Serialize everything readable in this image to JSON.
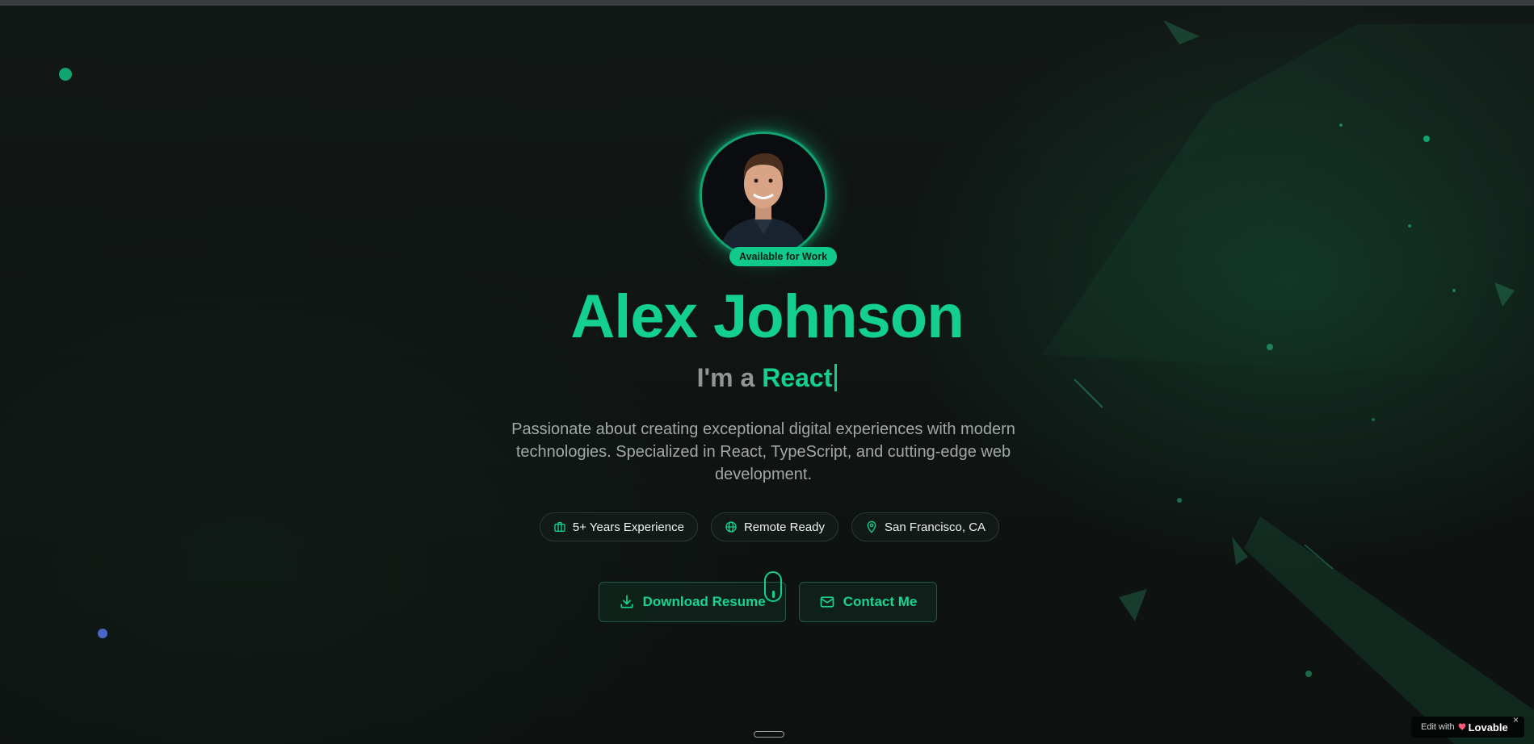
{
  "profile": {
    "name": "Alex Johnson",
    "badge": "Available for Work",
    "role_prefix": "I'm a",
    "role_word": "React",
    "description": "Passionate about creating exceptional digital experiences with modern technologies. Specialized in React, TypeScript, and cutting-edge web development."
  },
  "highlights": [
    {
      "icon": "briefcase-icon",
      "label": "5+ Years Experience"
    },
    {
      "icon": "globe-icon",
      "label": "Remote Ready"
    },
    {
      "icon": "map-pin-icon",
      "label": "San Francisco, CA"
    }
  ],
  "actions": {
    "download_label": "Download Resume",
    "contact_label": "Contact Me"
  },
  "lovable_badge": {
    "prefix": "Edit with",
    "brand": "Lovable",
    "close": "×"
  },
  "colors": {
    "accent": "#13d08f",
    "background": "#0f1312",
    "badge_bg": "#10c98a"
  }
}
